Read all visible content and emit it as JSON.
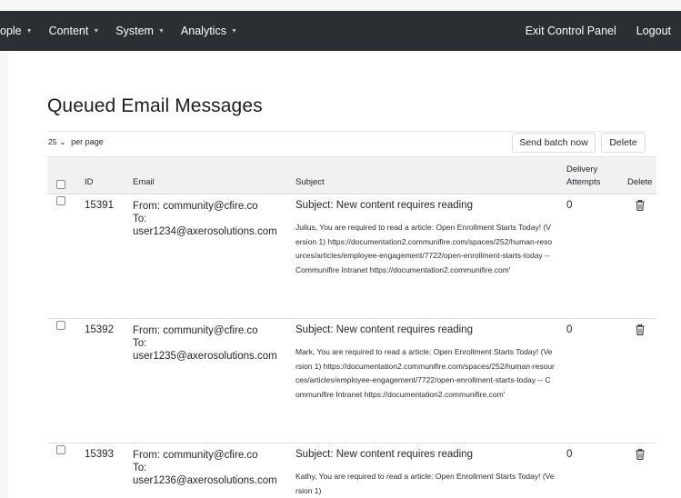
{
  "nav": {
    "left": [
      {
        "label": "ople",
        "dropdown": true
      },
      {
        "label": "Content",
        "dropdown": true
      },
      {
        "label": "System",
        "dropdown": true
      },
      {
        "label": "Analytics",
        "dropdown": true
      }
    ],
    "right": [
      {
        "label": "Exit Control Panel"
      },
      {
        "label": "Logout"
      }
    ]
  },
  "page": {
    "title": "Queued Email Messages"
  },
  "controls": {
    "per_page_value": "25",
    "per_page_label": "per page",
    "send_batch_label": "Send batch now",
    "delete_label": "Delete"
  },
  "table": {
    "headers": {
      "id": "ID",
      "email": "Email",
      "subject": "Subject",
      "attempts_line1": "Delivery",
      "attempts_line2": "Attempts",
      "delete": "Delete"
    },
    "rows": [
      {
        "id": "15391",
        "from": "From: community@cfire.co",
        "to_label": "To:",
        "to": "user1234@axerosolutions.com",
        "subject": "Subject: New content requires reading",
        "body": "Julius, You are required to read a article: Open Enrollment Starts Today! (Version 1) https://documentation2.communifire.com/spaces/252/human-resources/articles/employee-engagement/7722/open-enrollment-starts-today -- Communifire Intranet https://documentation2.communifire.com'",
        "attempts": "0"
      },
      {
        "id": "15392",
        "from": "From: community@cfire.co",
        "to_label": "To:",
        "to": "user1235@axerosolutions.com",
        "subject": "Subject: New content requires reading",
        "body": "Mark, You are required to read a article: Open Enrollment Starts Today! (Version 1) https://documentation2.communifire.com/spaces/252/human-resources/articles/employee-engagement/7722/open-enrollment-starts-today -- Communifire Intranet https://documentation2.communifire.com'",
        "attempts": "0"
      },
      {
        "id": "15393",
        "from": "From: community@cfire.co",
        "to_label": "To:",
        "to": "user1236@axerosolutions.com",
        "subject": "Subject: New content requires reading",
        "body": "Kathy, You are required to read a article: Open Enrollment Starts Today! (Version 1)",
        "attempts": "0"
      }
    ]
  },
  "icons": {
    "caret": "caret-down-icon",
    "select_chevron": "chevron-down-icon",
    "delete": "trash-icon"
  },
  "colors": {
    "topbar": "#2b2e33",
    "header_bg": "#f1f1f2",
    "page_bg": "#ffffff"
  }
}
